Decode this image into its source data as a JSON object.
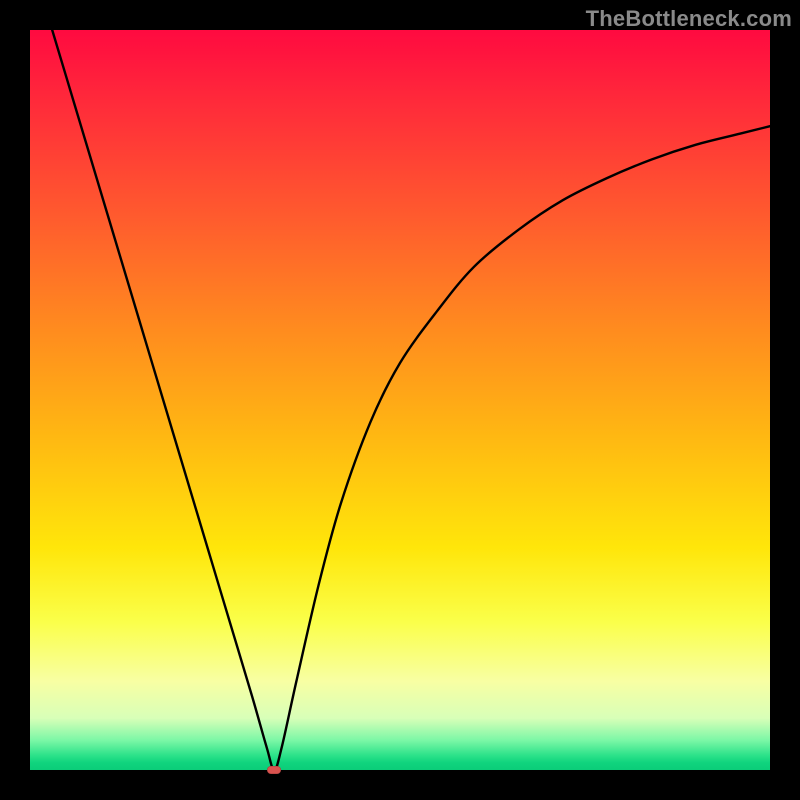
{
  "watermark": "TheBottleneck.com",
  "chart_data": {
    "type": "line",
    "title": "",
    "xlabel": "",
    "ylabel": "",
    "xlim": [
      0,
      100
    ],
    "ylim": [
      0,
      100
    ],
    "grid": false,
    "legend": false,
    "background_gradient": {
      "orientation": "vertical",
      "stops": [
        {
          "pos": 0,
          "color": "#ff0a40"
        },
        {
          "pos": 25,
          "color": "#ff5a2e"
        },
        {
          "pos": 55,
          "color": "#ffb812"
        },
        {
          "pos": 80,
          "color": "#faff4a"
        },
        {
          "pos": 95,
          "color": "#7bf7a6"
        },
        {
          "pos": 100,
          "color": "#0bcd79"
        }
      ]
    },
    "series": [
      {
        "name": "bottleneck-curve",
        "color": "#000000",
        "x": [
          3,
          6,
          9,
          12,
          15,
          18,
          21,
          24,
          27,
          30,
          32,
          33,
          34,
          36,
          39,
          42,
          46,
          50,
          55,
          60,
          66,
          72,
          78,
          84,
          90,
          96,
          100
        ],
        "y": [
          100,
          90,
          80,
          70,
          60,
          50,
          40,
          30,
          20,
          10,
          3,
          0,
          3,
          12,
          25,
          36,
          47,
          55,
          62,
          68,
          73,
          77,
          80,
          82.5,
          84.5,
          86,
          87
        ]
      }
    ],
    "annotations": [
      {
        "name": "optimum-marker",
        "x": 33,
        "y": 0,
        "shape": "rounded-rect",
        "color": "#d9534f"
      }
    ]
  }
}
